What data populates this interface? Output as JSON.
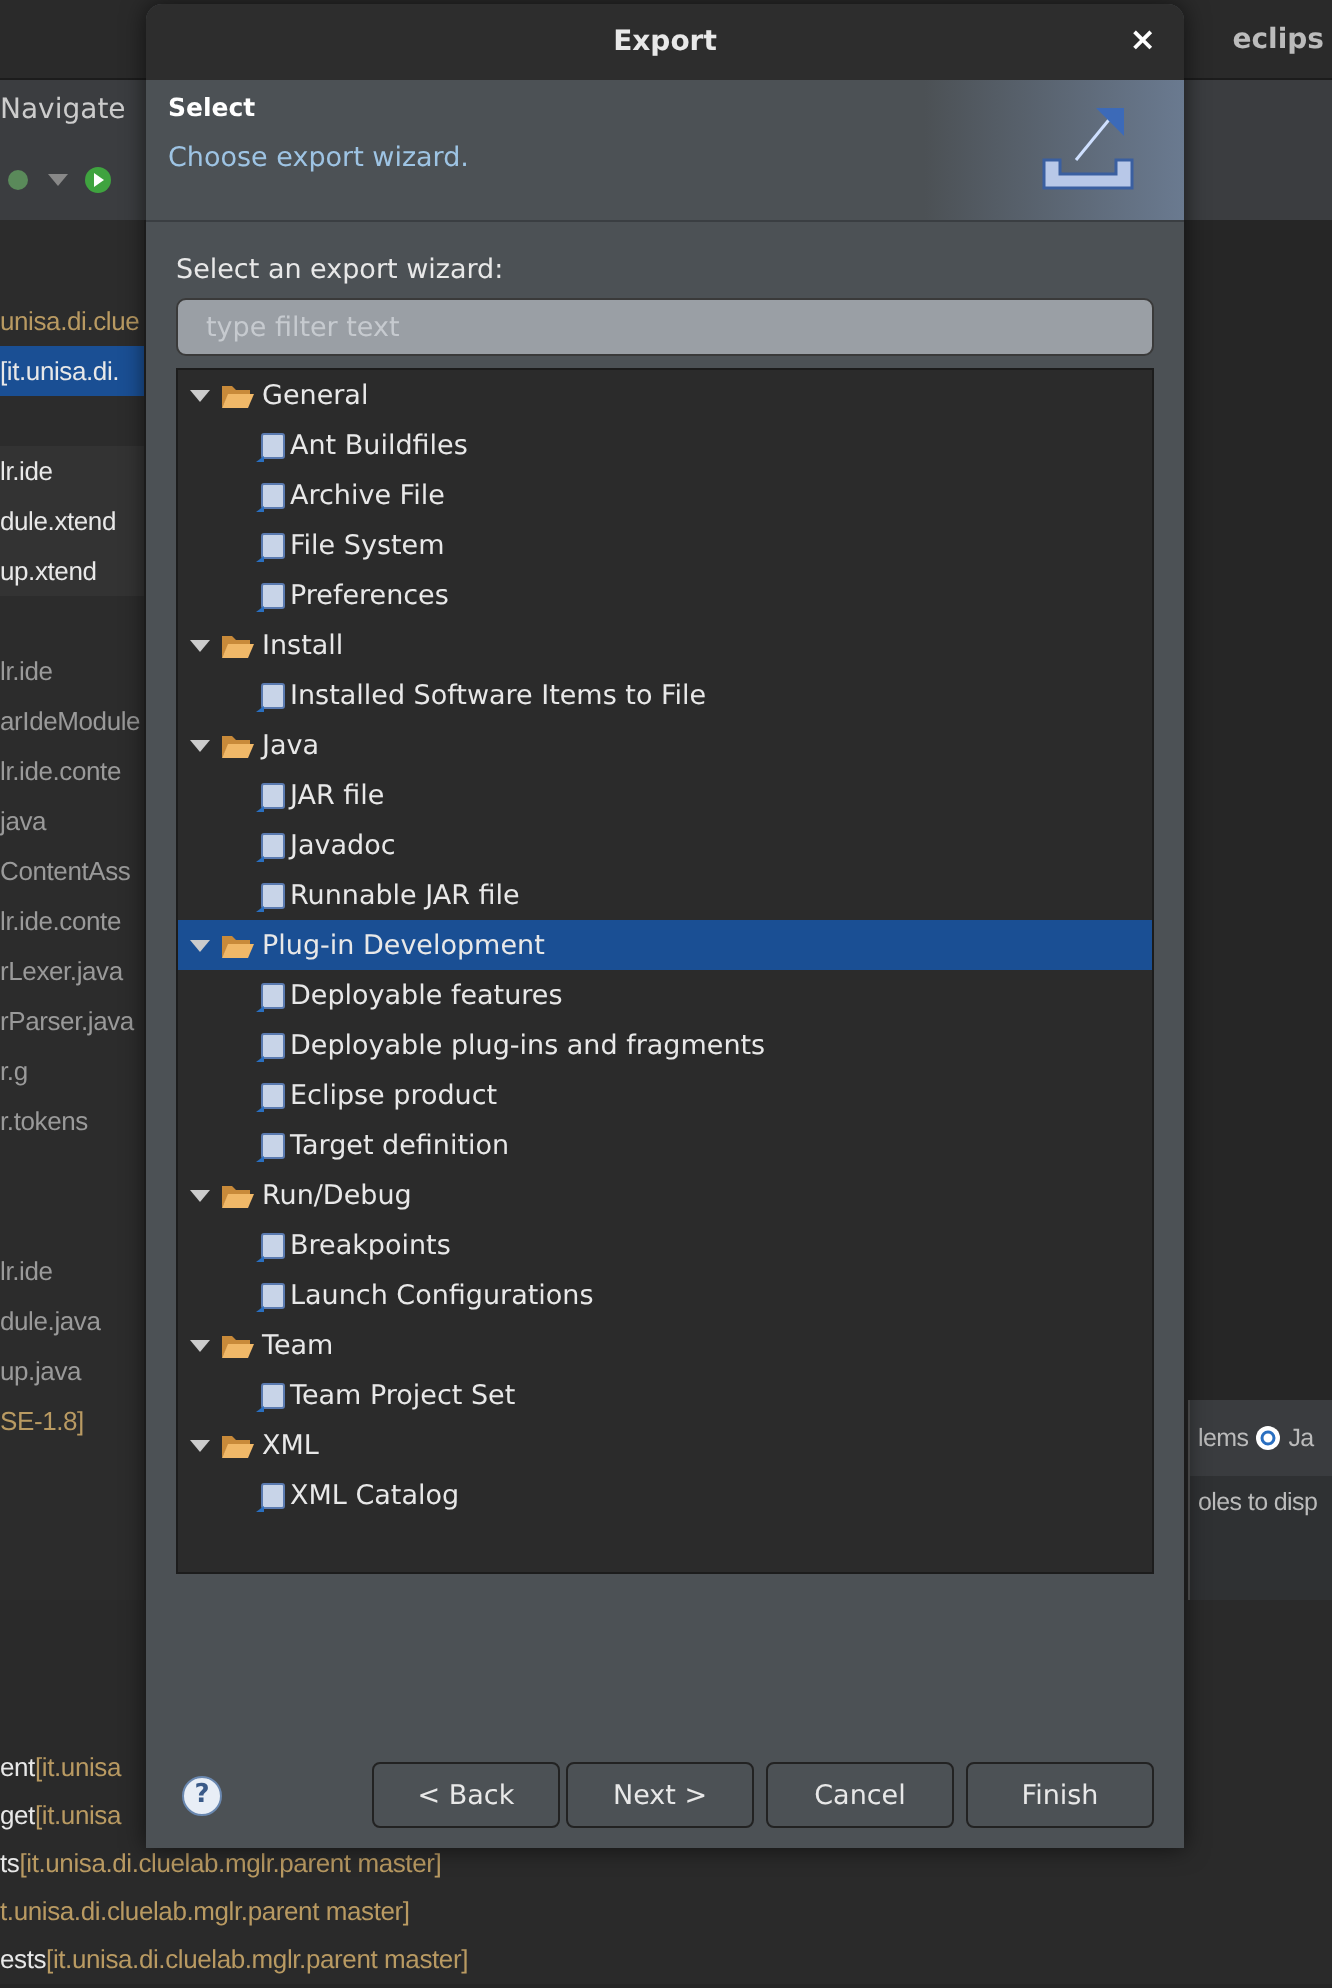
{
  "ide": {
    "title": "eclips",
    "menu": [
      "Navigate"
    ],
    "explorer_sections": [
      {
        "rows": [
          {
            "decoration": "unisa.di.clue",
            "selected": false
          },
          {
            "name": "[it.unisa.di.",
            "selected": true,
            "dimmed": false
          }
        ]
      },
      {
        "rows": [
          {
            "name": "lr.ide",
            "selected": false,
            "dimmed": false
          },
          {
            "name": "dule.xtend",
            "selected": false,
            "dimmed": false
          },
          {
            "name": "up.xtend",
            "selected": false,
            "dimmed": false
          }
        ]
      },
      {
        "rows": [
          {
            "name": "lr.ide",
            "selected": false,
            "dimmed": true
          },
          {
            "name": "arIdeModule",
            "selected": false,
            "dimmed": true
          },
          {
            "name": "lr.ide.conte",
            "selected": false,
            "dimmed": true
          },
          {
            "name": "java",
            "selected": false,
            "dimmed": true
          },
          {
            "name": "ContentAss",
            "selected": false,
            "dimmed": true
          },
          {
            "name": "lr.ide.conte",
            "selected": false,
            "dimmed": true
          },
          {
            "name": "rLexer.java",
            "selected": false,
            "dimmed": true
          },
          {
            "name": "rParser.java",
            "selected": false,
            "dimmed": true
          },
          {
            "name": "r.g",
            "selected": false,
            "dimmed": true
          },
          {
            "name": "r.tokens",
            "selected": false,
            "dimmed": true
          }
        ]
      },
      {
        "rows": [
          {
            "name": "lr.ide",
            "selected": false,
            "dimmed": true
          },
          {
            "name": "dule.java",
            "selected": false,
            "dimmed": true
          },
          {
            "name": "up.java",
            "selected": false,
            "dimmed": true
          },
          {
            "decoration": "SE-1.8]",
            "selected": false
          }
        ]
      }
    ],
    "console_rows": [
      {
        "name": "ent",
        "decoration": "[it.unisa"
      },
      {
        "name": "get",
        "decoration": "[it.unisa"
      },
      {
        "name": "ts",
        "decoration": "[it.unisa.di.cluelab.mglr.parent master]"
      },
      {
        "decoration": "t.unisa.di.cluelab.mglr.parent master]"
      },
      {
        "name": "ests",
        "decoration": "[it.unisa.di.cluelab.mglr.parent master]"
      }
    ],
    "side_panel": {
      "tabs": [
        "lems",
        "Ja"
      ],
      "message": "oles to disp"
    }
  },
  "dialog": {
    "title": "Export",
    "close": "×",
    "header_title": "Select",
    "header_message": "Choose export wizard.",
    "filter_label": "Select an export wizard:",
    "filter": {
      "placeholder": "type filter text"
    },
    "tree": [
      {
        "label": "General",
        "expanded": true,
        "selected": false,
        "children": [
          {
            "label": "Ant Buildfiles"
          },
          {
            "label": "Archive File"
          },
          {
            "label": "File System"
          },
          {
            "label": "Preferences"
          }
        ]
      },
      {
        "label": "Install",
        "expanded": true,
        "selected": false,
        "children": [
          {
            "label": "Installed Software Items to File"
          }
        ]
      },
      {
        "label": "Java",
        "expanded": true,
        "selected": false,
        "children": [
          {
            "label": "JAR file"
          },
          {
            "label": "Javadoc"
          },
          {
            "label": "Runnable JAR file"
          }
        ]
      },
      {
        "label": "Plug-in Development",
        "expanded": true,
        "selected": true,
        "children": [
          {
            "label": "Deployable features"
          },
          {
            "label": "Deployable plug-ins and fragments"
          },
          {
            "label": "Eclipse product"
          },
          {
            "label": "Target definition"
          }
        ]
      },
      {
        "label": "Run/Debug",
        "expanded": true,
        "selected": false,
        "children": [
          {
            "label": "Breakpoints"
          },
          {
            "label": "Launch Configurations"
          }
        ]
      },
      {
        "label": "Team",
        "expanded": true,
        "selected": false,
        "children": [
          {
            "label": "Team Project Set"
          }
        ]
      },
      {
        "label": "XML",
        "expanded": true,
        "selected": false,
        "children": [
          {
            "label": "XML Catalog"
          }
        ]
      }
    ],
    "help": "?",
    "buttons": [
      {
        "label": "< Back",
        "disabled": false
      },
      {
        "label": "Next >",
        "disabled": false
      },
      {
        "label": "Cancel",
        "disabled": false
      },
      {
        "label": "Finish",
        "disabled": false
      }
    ]
  }
}
